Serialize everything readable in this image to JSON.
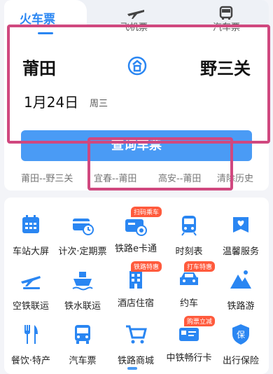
{
  "tabs": {
    "train": "火车票",
    "flight": "飞机票",
    "bus": "汽车票"
  },
  "search": {
    "from": "莆田",
    "to": "野三关",
    "date": "1月24日",
    "weekday": "周三",
    "button": "查询车票"
  },
  "history": [
    "莆田--野三关",
    "宜春--莆田",
    "高安--莆田",
    "清除历史"
  ],
  "menu": [
    {
      "label": "车站大屏",
      "icon": "calendar-icon",
      "badge": ""
    },
    {
      "label": "计次·定期票",
      "icon": "card-clock-icon",
      "badge": ""
    },
    {
      "label": "铁路e卡通",
      "icon": "e-card-icon",
      "badge": "扫码乘车"
    },
    {
      "label": "时刻表",
      "icon": "train-front-icon",
      "badge": ""
    },
    {
      "label": "温馨服务",
      "icon": "heart-service-icon",
      "badge": ""
    },
    {
      "label": "空铁联运",
      "icon": "plane-train-icon",
      "badge": ""
    },
    {
      "label": "铁水联运",
      "icon": "ship-icon",
      "badge": ""
    },
    {
      "label": "酒店住宿",
      "icon": "hotel-icon",
      "badge": "铁路特惠"
    },
    {
      "label": "约车",
      "icon": "car-icon",
      "badge": "打车特惠"
    },
    {
      "label": "铁路游",
      "icon": "mountain-icon",
      "badge": ""
    },
    {
      "label": "餐饮·特产",
      "icon": "fork-knife-icon",
      "badge": ""
    },
    {
      "label": "汽车票",
      "icon": "bus-icon",
      "badge": ""
    },
    {
      "label": "铁路商城",
      "icon": "cart-icon",
      "badge": ""
    },
    {
      "label": "中铁畅行卡",
      "icon": "member-card-icon",
      "badge": "购票立减"
    },
    {
      "label": "出行保险",
      "icon": "shield-insurance-icon",
      "badge": ""
    }
  ],
  "colors": {
    "accent": "#2a86f2",
    "highlight": "#d0487f",
    "badge": "#ff5a3c"
  }
}
